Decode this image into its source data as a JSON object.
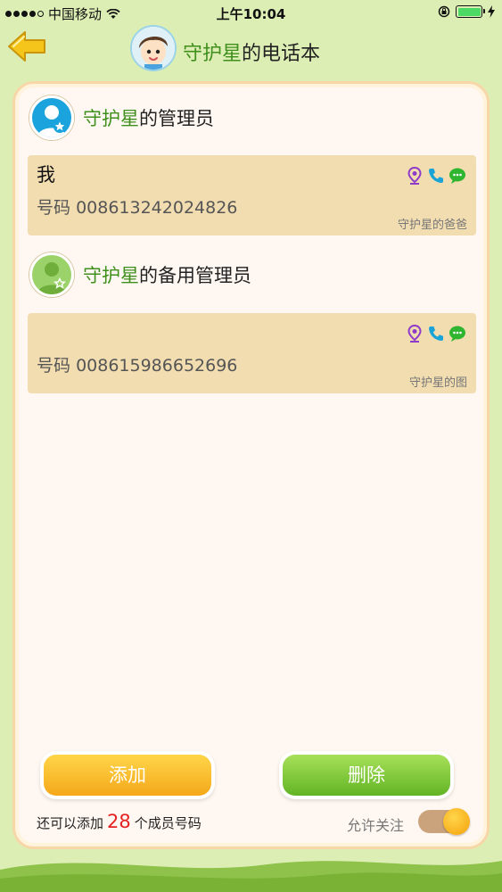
{
  "status_bar": {
    "carrier": "中国移动",
    "time": "上午10:04"
  },
  "header": {
    "title_name": "守护星",
    "title_suffix": "的电话本"
  },
  "admin_section": {
    "name": "守护星",
    "suffix": "的管理员",
    "contact": {
      "name": "我",
      "number_label": "号码",
      "number": "008613242024826",
      "relation": "守护星的爸爸"
    }
  },
  "backup_section": {
    "name": "守护星",
    "suffix": "的备用管理员",
    "contact": {
      "name": "",
      "number_label": "号码",
      "number": "008615986652696",
      "relation": "守护星的图"
    }
  },
  "actions": {
    "add_label": "添加",
    "delete_label": "删除"
  },
  "footer": {
    "prefix": "还可以添加",
    "count": "28",
    "suffix": "个成员号码",
    "follow_label": "允许关注",
    "follow_enabled": true
  },
  "icons": [
    "back-arrow-icon",
    "location-icon",
    "phone-icon",
    "chat-icon"
  ],
  "colors": {
    "accent_green": "#3f8f1c",
    "add_button": "#f5a81a",
    "delete_button": "#62b424",
    "count_red": "#e52222",
    "contact_bg": "#f2ddb1"
  }
}
